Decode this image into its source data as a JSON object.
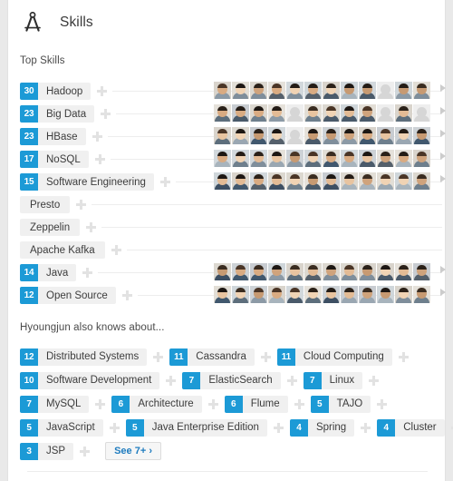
{
  "header": {
    "icon": "compass-icon",
    "title": "Skills"
  },
  "sections": {
    "top_skills_label": "Top Skills",
    "also_knows_label": "Hyoungjun also knows about..."
  },
  "colors": {
    "count_badge": "#1c9ad6",
    "chip_background": "#f0f0f0",
    "link": "#1f7cbf",
    "page_background": "#e9e9e9",
    "card_background": "#ffffff"
  },
  "top_skills": [
    {
      "count": "30",
      "name": "Hadoop",
      "endorsers": 12
    },
    {
      "count": "23",
      "name": "Big Data",
      "endorsers": 12
    },
    {
      "count": "23",
      "name": "HBase",
      "endorsers": 12
    },
    {
      "count": "17",
      "name": "NoSQL",
      "endorsers": 12
    },
    {
      "count": "15",
      "name": "Software Engineering",
      "endorsers": 12
    },
    {
      "count": "",
      "name": "Presto",
      "endorsers": 0
    },
    {
      "count": "",
      "name": "Zeppelin",
      "endorsers": 0
    },
    {
      "count": "",
      "name": "Apache Kafka",
      "endorsers": 0
    },
    {
      "count": "14",
      "name": "Java",
      "endorsers": 12
    },
    {
      "count": "12",
      "name": "Open Source",
      "endorsers": 12
    }
  ],
  "also_knows": [
    [
      {
        "count": "12",
        "name": "Distributed Systems"
      },
      {
        "count": "11",
        "name": "Cassandra"
      },
      {
        "count": "11",
        "name": "Cloud Computing"
      }
    ],
    [
      {
        "count": "10",
        "name": "Software Development"
      },
      {
        "count": "7",
        "name": "ElasticSearch"
      },
      {
        "count": "7",
        "name": "Linux"
      }
    ],
    [
      {
        "count": "7",
        "name": "MySQL"
      },
      {
        "count": "6",
        "name": "Architecture"
      },
      {
        "count": "6",
        "name": "Flume"
      },
      {
        "count": "5",
        "name": "TAJO"
      }
    ],
    [
      {
        "count": "5",
        "name": "JavaScript"
      },
      {
        "count": "5",
        "name": "Java Enterprise Edition"
      },
      {
        "count": "4",
        "name": "Spring"
      },
      {
        "count": "4",
        "name": "Cluster"
      }
    ],
    [
      {
        "count": "3",
        "name": "JSP"
      }
    ]
  ],
  "see_more_label": "See 7+ ›"
}
